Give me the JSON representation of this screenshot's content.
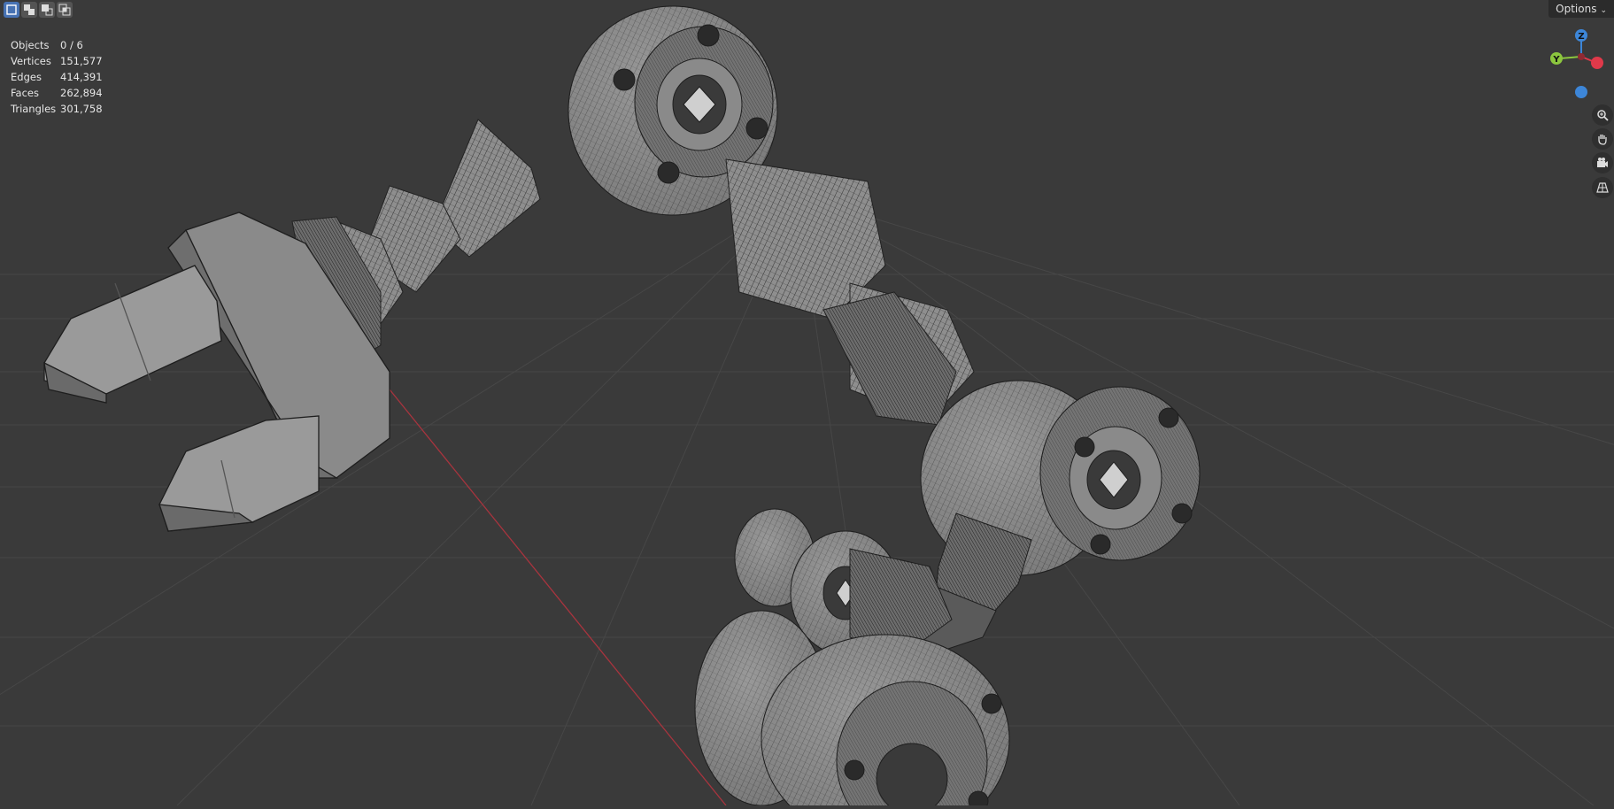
{
  "header": {
    "mode_buttons": [
      "select-box-icon",
      "select-extend-icon",
      "select-subtract-icon",
      "select-intersect-icon"
    ],
    "options_label": "Options"
  },
  "stats": {
    "rows": [
      {
        "label": "Objects",
        "value": "0 / 6"
      },
      {
        "label": "Vertices",
        "value": "151,577"
      },
      {
        "label": "Edges",
        "value": "414,391"
      },
      {
        "label": "Faces",
        "value": "262,894"
      },
      {
        "label": "Triangles",
        "value": "301,758"
      }
    ]
  },
  "gizmo": {
    "z": "Z",
    "y": "Y",
    "x": "X",
    "colors": {
      "x": "#e0394a",
      "y": "#8cc63e",
      "z": "#3d86d8"
    }
  },
  "nav_tools": [
    "zoom-icon",
    "pan-hand-icon",
    "camera-icon",
    "grid-perspective-icon"
  ],
  "scene": {
    "object": "robot-arm-wireframe",
    "colors": {
      "bg": "#3a3a3a",
      "grid": "#4a4a4a",
      "xaxis": "#a8343e",
      "mesh": "#8e8e8e",
      "wire": "#1e1e1e"
    }
  }
}
